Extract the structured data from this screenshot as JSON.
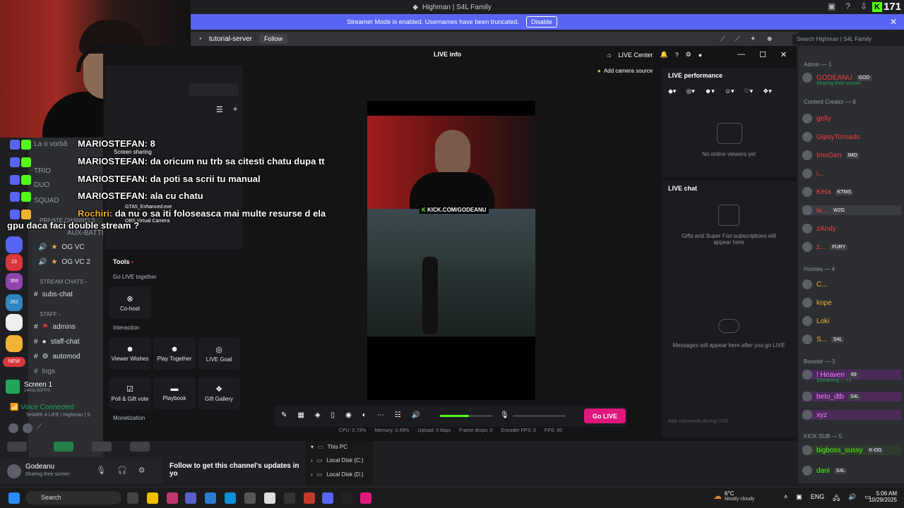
{
  "window": {
    "title": "Highman | S4L Family",
    "streamer_banner": "Streamer Mode is enabled. Usernames have been truncated.",
    "disable_label": "Disable",
    "kick_count": "171"
  },
  "discord_header": {
    "channel": "tutorial-server",
    "follow_label": "Follow",
    "search_placeholder": "Search Highman | S4L Family"
  },
  "channels": {
    "items": [
      {
        "name": "La o vorbă"
      },
      {
        "name": "TRIO"
      },
      {
        "name": "DUO"
      },
      {
        "name": "SQUAD"
      },
      {
        "name": "PRIVATE CHANNELS"
      },
      {
        "name": "AUX-BATTL"
      },
      {
        "name": "OG VC"
      },
      {
        "name": "OG VC 2"
      }
    ],
    "stream_chats_label": "STREAM CHATS -",
    "subs_chat": "subs-chat",
    "staff_label": "STAFF -",
    "admins": "admins",
    "staff_chat": "staff-chat",
    "automod": "automod",
    "logs": "logs"
  },
  "guild_badges": {
    "b1": "23",
    "b2": "368",
    "b3": "262",
    "new": "NEW"
  },
  "chat_overlay": [
    {
      "user": "MARIOSTEFAN:",
      "msg": "8"
    },
    {
      "user": "MARIOSTEFAN:",
      "msg": "da oricum nu trb sa citesti chatu dupa tt"
    },
    {
      "user": "MARIOSTEFAN:",
      "msg": "da poti sa scrii tu manual"
    },
    {
      "user": "MARIOSTEFAN:",
      "msg": "ala cu chatu"
    },
    {
      "user": "Rochiri:",
      "msg": "da nu o sa iti foloseasca mai multe resurse d ela"
    },
    {
      "user": "",
      "msg": "gpu daca faci double stream ?"
    }
  ],
  "studio": {
    "title": "LIVE info",
    "live_center": "LIVE Center",
    "add_camera": "Add camera source",
    "notif_count": "2",
    "sources": [
      "Screen sharing",
      "GTA5_Enhanced.exe",
      "OBS Virtual Camera"
    ],
    "tools_label": "Tools",
    "go_live_together": "Go LIVE together",
    "cohost": "Co-host",
    "interaction": "Interaction",
    "interaction_tools": [
      "Viewer Wishes",
      "Play Together",
      "LIVE Goal",
      "Poll & Gift vote",
      "Playbook",
      "Gift Gallery"
    ],
    "monetization": "Monetization",
    "overlay_url": "KICK.COM/GODEANU",
    "go_live": "Go LIVE",
    "stats": [
      "CPU: 0.73%",
      "Memory: 0.49%",
      "Upload: 0 kbps",
      "Frame drops: 0",
      "Encoder FPS: 0",
      "FPS: 60"
    ],
    "volume_level": 0.55
  },
  "perf": {
    "title": "LIVE performance",
    "empty": "No online viewers yet"
  },
  "livechat": {
    "title": "LIVE chat",
    "gifts_note": "Gifts and Super Fan subscriptions will appear here",
    "messages_note": "Messages will appear here after you go LIVE",
    "input_placeholder": "Add comments during LIVE"
  },
  "members": {
    "admin_header": "Admin — 1",
    "admin": {
      "name": "GODEANU",
      "tag": "GOD",
      "status": "Sharing their screen"
    },
    "cc_header": "Content Creator — 8",
    "cc": [
      {
        "name": "gelly",
        "tag": ""
      },
      {
        "name": "GipsyTornado",
        "tag": ""
      },
      {
        "name": "ImoGen",
        "tag": "IMO"
      },
      {
        "name": "i...",
        "tag": ""
      },
      {
        "name": "Keta",
        "tag": "KTMS"
      },
      {
        "name": "w...",
        "tag": "W2G"
      },
      {
        "name": "zAndy",
        "tag": ""
      },
      {
        "name": "z...",
        "tag": "FURY"
      }
    ],
    "homies_header": "Homies — 4",
    "homies": [
      {
        "name": "C...",
        "tag": ""
      },
      {
        "name": "kope",
        "tag": ""
      },
      {
        "name": "Loki",
        "tag": ""
      },
      {
        "name": "S...",
        "tag": "S4L"
      }
    ],
    "booster_header": "Booster — 3",
    "boosters": [
      {
        "name": "! Heaven",
        "tag": "69",
        "status": "Streaming ... +1"
      },
      {
        "name": "beto_dtb",
        "tag": "S4L"
      },
      {
        "name": "xyz",
        "tag": ""
      }
    ],
    "kicksub_header": "KICK SUB — 5",
    "kicksub": [
      {
        "name": "bigboss_sussy",
        "tag": "K-OG"
      },
      {
        "name": "dani",
        "tag": "S4L"
      }
    ]
  },
  "voice": {
    "screen_label": "Screen 1",
    "screen_sub": "1440p 60FPS",
    "connected": "Voice Connected",
    "server": "SHARK 4 LIFE / Highman | S"
  },
  "user": {
    "name": "Godeanu",
    "status": "Sharing their screen"
  },
  "follow_text": "Follow to get this channel's updates in yo",
  "explorer": {
    "this_pc": "This PC",
    "disk_c": "Local Disk (C:)",
    "disk_d": "Local Disk (D:)"
  },
  "taskbar": {
    "search": "Search",
    "weather_temp": "6°C",
    "weather_desc": "Mostly cloudy",
    "lang": "ENG",
    "time": "5:06 AM",
    "date": "10/29/2025"
  },
  "colors": {
    "kick_green": "#53fc18",
    "golive_pink": "#e0177d",
    "discord_blurple": "#5865f2"
  }
}
